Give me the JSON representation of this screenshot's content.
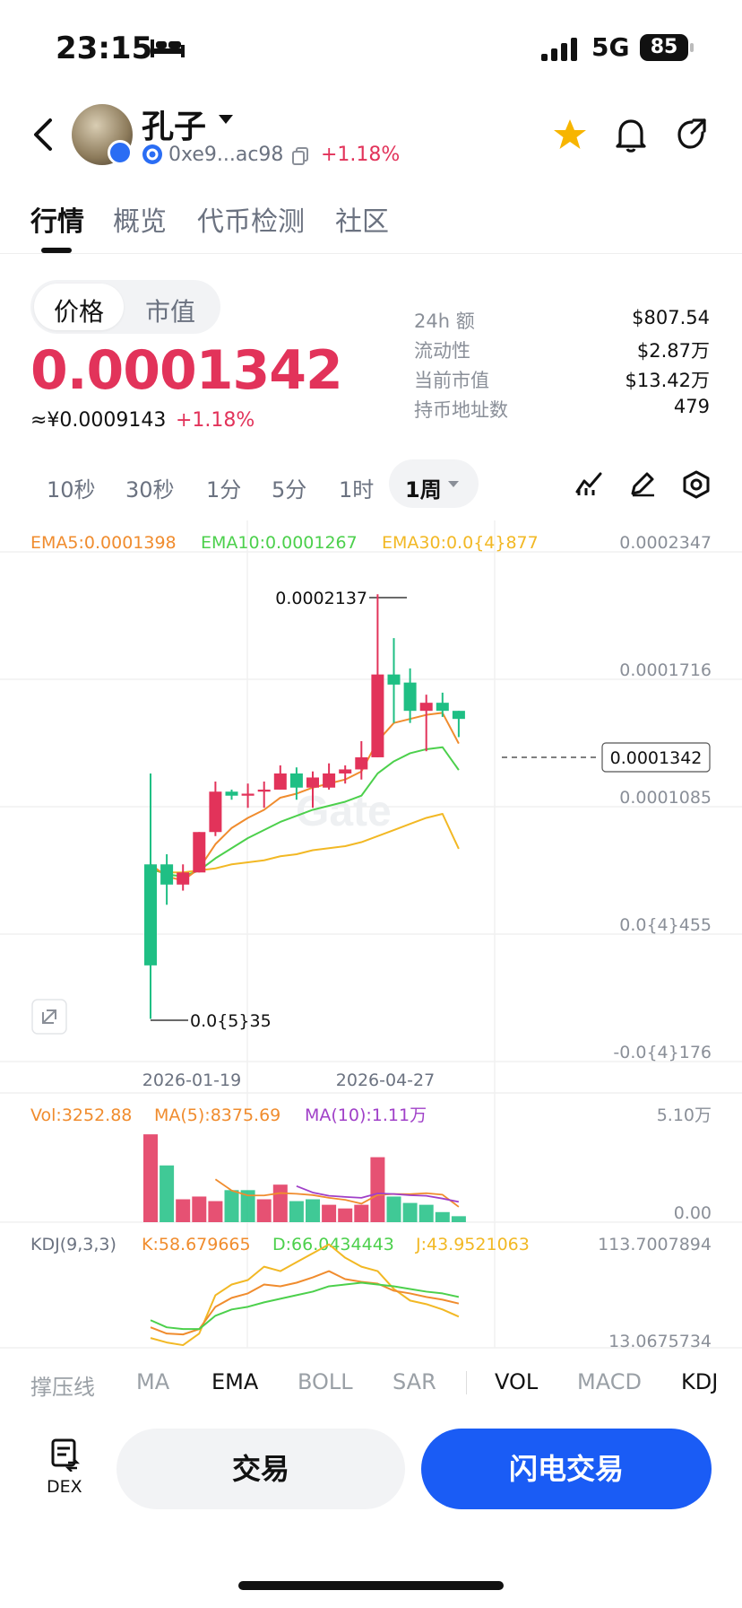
{
  "status": {
    "time": "23:15",
    "network": "5G",
    "battery": "85"
  },
  "header": {
    "token_name": "孔子",
    "address": "0xe9...ac98",
    "change": "+1.18%"
  },
  "tabs": [
    "行情",
    "概览",
    "代币检测",
    "社区"
  ],
  "price_toggle": {
    "price": "价格",
    "market_cap": "市值"
  },
  "price": "0.0001342",
  "cny_price": "≈¥0.0009143",
  "change_pct": "+1.18%",
  "stats": [
    {
      "label": "24h  额",
      "value": "$807.54"
    },
    {
      "label": "流动性",
      "value": "$2.87万"
    },
    {
      "label": "当前市值",
      "value": "$13.42万"
    },
    {
      "label": "持币地址数",
      "value": "479"
    }
  ],
  "timeframes": [
    "10秒",
    "30秒",
    "1分",
    "5分",
    "1时",
    "1周"
  ],
  "main_chart": {
    "ema5": "EMA5:0.0001398",
    "ema10": "EMA10:0.0001267",
    "ema30": "EMA30:0.0{4}877",
    "y_ticks": [
      "0.0002347",
      "0.0001716",
      "0.0001085",
      "0.0{4}455",
      "-0.0{4}176"
    ],
    "high_label": "0.0002137",
    "low_label": "0.0{5}35",
    "current_tag": "0.0001342",
    "x_ticks": [
      "2026-01-19",
      "2026-04-27"
    ],
    "watermark": "Gate"
  },
  "volume": {
    "vol": "Vol:3252.88",
    "ma5": "MA(5):8375.69",
    "ma10": "MA(10):1.11万",
    "y_top": "5.10万",
    "y_bottom": "0.00"
  },
  "kdj": {
    "title": "KDJ(9,3,3)",
    "k": "K:58.679665",
    "d": "D:66.0434443",
    "j": "J:43.9521063",
    "y_top": "113.7007894",
    "y_bottom": "13.0675734"
  },
  "indicator_tabs": [
    "撑压线",
    "MA",
    "EMA",
    "BOLL",
    "SAR",
    "VOL",
    "MACD",
    "KDJ"
  ],
  "actions": {
    "dex": "DEX",
    "trade": "交易",
    "flash": "闪电交易"
  },
  "colors": {
    "up": "#e2335a",
    "down": "#1fbf84",
    "ema5": "#f08c2e",
    "ema10": "#4cd04c",
    "ema30": "#f2b824",
    "brand": "#1a5cf5"
  },
  "chart_data": {
    "type": "candlestick",
    "candles": [
      {
        "o": 8e-05,
        "c": 3e-05,
        "h": 0.000125,
        "l": 3.5e-06
      },
      {
        "o": 8e-05,
        "c": 7e-05,
        "h": 8.5e-05,
        "l": 6e-05
      },
      {
        "o": 7e-05,
        "c": 7.6e-05,
        "h": 8e-05,
        "l": 6.7e-05
      },
      {
        "o": 7.6e-05,
        "c": 9.6e-05,
        "h": 9.6e-05,
        "l": 7.6e-05
      },
      {
        "o": 9.6e-05,
        "c": 0.000116,
        "h": 0.000121,
        "l": 9.4e-05
      },
      {
        "o": 0.000116,
        "c": 0.000114,
        "h": 0.000117,
        "l": 0.000112
      },
      {
        "o": 0.000114,
        "c": 0.000115,
        "h": 0.00012,
        "l": 0.000108
      },
      {
        "o": 0.000116,
        "c": 0.000117,
        "h": 0.000121,
        "l": 0.000108
      },
      {
        "o": 0.000117,
        "c": 0.000125,
        "h": 0.000129,
        "l": 0.000117
      },
      {
        "o": 0.000125,
        "c": 0.000118,
        "h": 0.000128,
        "l": 0.000112
      },
      {
        "o": 0.000118,
        "c": 0.000123,
        "h": 0.000126,
        "l": 0.000108
      },
      {
        "o": 0.000118,
        "c": 0.000125,
        "h": 0.00013,
        "l": 0.000117
      },
      {
        "o": 0.000125,
        "c": 0.000127,
        "h": 0.000129,
        "l": 0.00012
      },
      {
        "o": 0.000127,
        "c": 0.000133,
        "h": 0.000141,
        "l": 0.000122
      },
      {
        "o": 0.000133,
        "c": 0.000174,
        "h": 0.0002137,
        "l": 0.000133
      },
      {
        "o": 0.000174,
        "c": 0.000169,
        "h": 0.000192,
        "l": 0.00015
      },
      {
        "o": 0.00017,
        "c": 0.000156,
        "h": 0.000177,
        "l": 0.00015
      },
      {
        "o": 0.000156,
        "c": 0.00016,
        "h": 0.000164,
        "l": 0.000136
      },
      {
        "o": 0.00016,
        "c": 0.000156,
        "h": 0.000165,
        "l": 0.000153
      },
      {
        "o": 0.000156,
        "c": 0.000152,
        "h": 0.000156,
        "l": 0.000143
      }
    ],
    "ema5": [
      8e-05,
      7.4e-05,
      7.2e-05,
      7.8e-05,
      9e-05,
      9.8e-05,
      0.000103,
      0.000107,
      0.000113,
      0.000115,
      0.000118,
      0.00012,
      0.000122,
      0.000126,
      0.000141,
      0.00015,
      0.000152,
      0.000154,
      0.000155,
      0.0001398
    ],
    "ema10": [
      7.8e-05,
      7.5e-05,
      7.4e-05,
      7.7e-05,
      8.3e-05,
      8.8e-05,
      9.3e-05,
      9.7e-05,
      0.000101,
      0.000104,
      0.000107,
      0.000109,
      0.000111,
      0.000114,
      0.000125,
      0.000131,
      0.000135,
      0.000137,
      0.000138,
      0.0001267
    ],
    "ema30": [
      7.7e-05,
      7.6e-05,
      7.6e-05,
      7.7e-05,
      7.8e-05,
      8e-05,
      8.1e-05,
      8.2e-05,
      8.4e-05,
      8.5e-05,
      8.7e-05,
      8.8e-05,
      8.9e-05,
      9.1e-05,
      9.4e-05,
      9.7e-05,
      0.0001,
      0.000103,
      0.000105,
      8.77e-05
    ],
    "ylim": [
      -1.76e-05,
      0.0002347
    ],
    "volume": [
      48000,
      31000,
      12500,
      14000,
      11500,
      17500,
      17500,
      12500,
      20500,
      11500,
      12500,
      9500,
      7500,
      9500,
      35500,
      14000,
      10500,
      9500,
      5500,
      3252.88
    ],
    "vol_up": [
      true,
      false,
      true,
      true,
      true,
      false,
      false,
      true,
      true,
      false,
      false,
      true,
      true,
      true,
      true,
      false,
      false,
      false,
      false,
      false
    ],
    "vol_ma5": [
      null,
      null,
      null,
      null,
      23400,
      17300,
      14600,
      14600,
      15900,
      15500,
      14800,
      13300,
      12200,
      10100,
      14900,
      15400,
      15300,
      15800,
      15000,
      8375.69
    ],
    "vol_ma10": [
      null,
      null,
      null,
      null,
      null,
      null,
      null,
      null,
      null,
      19700,
      16200,
      14400,
      13800,
      13300,
      15700,
      15400,
      14700,
      14400,
      12900,
      11100
    ],
    "vol_ylim": [
      0,
      51000
    ],
    "kdj_k": [
      32,
      25,
      24,
      30,
      55,
      65,
      70,
      80,
      78,
      82,
      88,
      95,
      86,
      83,
      81,
      73,
      70,
      66,
      63,
      58.68
    ],
    "kdj_d": [
      40,
      32,
      30,
      30,
      45,
      52,
      55,
      60,
      64,
      68,
      72,
      78,
      80,
      82,
      80,
      78,
      75,
      72,
      70,
      66.04
    ],
    "kdj_j": [
      20,
      15,
      12,
      25,
      68,
      80,
      85,
      100,
      95,
      105,
      115,
      125,
      110,
      100,
      95,
      75,
      62,
      58,
      52,
      43.95
    ],
    "kdj_ylim": [
      13.0675734,
      113.7007894
    ]
  }
}
